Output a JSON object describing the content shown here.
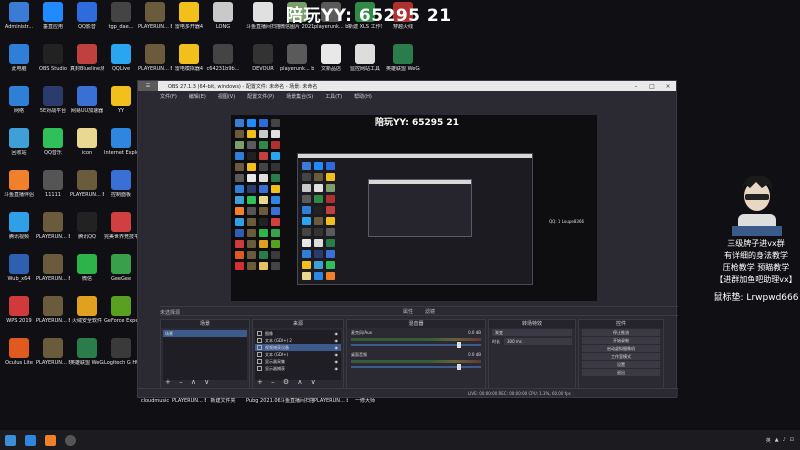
{
  "overlay_title": "陪玩YY: 65295 21",
  "side_info": {
    "lines": [
      "三级牌子进vx群",
      "有详细的身法教学",
      "压枪教学 预瞄教学",
      "【进群加鱼吧助理vx】"
    ],
    "mouse_label": "鼠标垫: Lrwpwd666"
  },
  "desktop_icons": [
    {
      "label": "Administr...",
      "color": "#3a7bd5"
    },
    {
      "label": "垂直应用",
      "color": "#1f8bff"
    },
    {
      "label": "QQ影音",
      "color": "#2e6bdc"
    },
    {
      "label": "tgp_dae...",
      "color": "#444"
    },
    {
      "label": "PLAYERUN... BATTLEGR...",
      "color": "#6b5b3d"
    },
    {
      "label": "雷电多开器4",
      "color": "#f2c01d"
    },
    {
      "label": "LONG",
      "color": "#c9c9c9"
    },
    {
      "label": "斗鱼直播间扫描()",
      "color": "#e0e0e0"
    },
    {
      "label": "微信图片 2021122...",
      "color": "#7a9f6a"
    },
    {
      "label": "playerunk... battlegrou...",
      "color": "#5a5a5a"
    },
    {
      "label": "新建 XLS 工作表",
      "color": "#2f8a46"
    },
    {
      "label": "穿越火线",
      "color": "#b03030"
    },
    {
      "label": "此电脑",
      "color": "#2f7fd8"
    },
    {
      "label": "OBS Studio",
      "color": "#222"
    },
    {
      "label": "真封Blueline测试版",
      "color": "#c04040"
    },
    {
      "label": "QQLive",
      "color": "#2aa5f0"
    },
    {
      "label": "PLAYERUN... BATTLEGR...",
      "color": "#6b5b3d"
    },
    {
      "label": "雷电模拟器4",
      "color": "#f2c01d"
    },
    {
      "label": "c64231b9b...",
      "color": "#444"
    },
    {
      "label": "DEVOUR",
      "color": "#333"
    },
    {
      "label": "playerunk... battlegrou...",
      "color": "#5a5a5a"
    },
    {
      "label": "文新品店",
      "color": "#e8e8e8"
    },
    {
      "label": "监控网站工具",
      "color": "#ddd"
    },
    {
      "label": "英雄联盟 WeGame版",
      "color": "#2a7d4a"
    },
    {
      "label": "网络",
      "color": "#2f7fd8"
    },
    {
      "label": "5E对战平台",
      "color": "#2b3b6b"
    },
    {
      "label": "网易UU加速器",
      "color": "#3a6fd5"
    },
    {
      "label": "YY",
      "color": "#f2c01d"
    },
    {
      "label": "回收站",
      "color": "#3fa0d8"
    },
    {
      "label": "QQ音乐",
      "color": "#30c05a"
    },
    {
      "label": "icon",
      "color": "#e8d890"
    },
    {
      "label": "Internet Explorer",
      "color": "#2e86de"
    },
    {
      "label": "斗鱼直播伴侣",
      "color": "#f0802a"
    },
    {
      "label": "11111",
      "color": "#555"
    },
    {
      "label": "PLAYERUN... BATTLEGR...",
      "color": "#6b5b3d"
    },
    {
      "label": "控制面板",
      "color": "#3a6fd5"
    },
    {
      "label": "腾讯视频",
      "color": "#2fa0e8"
    },
    {
      "label": "PLAYERUN... BATTLEGR...",
      "color": "#6b5b3d"
    },
    {
      "label": "腾讯QQ",
      "color": "#222"
    },
    {
      "label": "完美世界竞技平台",
      "color": "#d04040"
    },
    {
      "label": "Wub_x64",
      "color": "#2f5fb0"
    },
    {
      "label": "PLAYERUN... BATTLEGR...",
      "color": "#6b5b3d"
    },
    {
      "label": "微信",
      "color": "#2cb34a"
    },
    {
      "label": "GeeGee",
      "color": "#3a9f4a"
    },
    {
      "label": "WPS 2019",
      "color": "#d03a3a"
    },
    {
      "label": "PLAYERUN... BATTLEGR...",
      "color": "#6b5b3d"
    },
    {
      "label": "火绒安全软件",
      "color": "#e0a020"
    },
    {
      "label": "GeForce Experience",
      "color": "#5aa020"
    },
    {
      "label": "Oculus Lite",
      "color": "#e05a20"
    },
    {
      "label": "PLAYERUN... BATTLEGR...",
      "color": "#6b5b3d"
    },
    {
      "label": "英雄联盟 WeGame版",
      "color": "#2a7d4a"
    },
    {
      "label": "Logitech G HUB",
      "color": "#3a3a3a"
    },
    {
      "label": "cloudmusic",
      "color": "#d43030"
    },
    {
      "label": "PLAYERUN... BATTLEGR...",
      "color": "#6b5b3d"
    },
    {
      "label": "新建文件夹",
      "color": "#e8c060"
    },
    {
      "label": "Pubg 2021.06.10...",
      "color": "#444"
    },
    {
      "label": "斗鱼直播间扫描",
      "color": "#e0e0e0"
    },
    {
      "label": "PLAYERUN... battlegrou...",
      "color": "#5a5a5a"
    },
    {
      "label": "一修大师",
      "color": "#333"
    },
    {
      "label": "steam",
      "color": "#1b2838"
    },
    {
      "label": "腾讯游戏平台",
      "color": "#2a6fd0"
    }
  ],
  "obs": {
    "title": "OBS 27.1.3 (64-bit, windows) - 配置文件: 未命名 - 场景: 未命名",
    "menu": [
      "文件(F)",
      "编辑(E)",
      "视图(V)",
      "配置文件(P)",
      "场景集合(S)",
      "工具(T)",
      "帮助(H)"
    ],
    "mini_overlay": "陪玩YY: 65295 21",
    "mini_caption": "QQ: 1 Loupe8366",
    "scene_label": "未选择源",
    "toolbar": [
      "属性",
      "滤镜"
    ],
    "docks": {
      "scenes": {
        "title": "场景",
        "items": [
          "场景"
        ]
      },
      "sources": {
        "title": "来源",
        "items": [
          "图像",
          "文本 (GDI+) 2",
          "视频捕获设备",
          "文本 (GDI+)",
          "显示器采集",
          "显示器捕获"
        ]
      },
      "mixer": {
        "title": "混音器",
        "channels": [
          {
            "name": "麦克风/Aux",
            "level": "0.0 dB"
          },
          {
            "name": "桌面音频",
            "level": "0.0 dB"
          }
        ]
      },
      "transitions": {
        "title": "转场特效",
        "type": "渐变",
        "duration_label": "时长",
        "duration": "300 ms"
      },
      "controls": {
        "title": "控件",
        "buttons": [
          "停止推流",
          "开始录制",
          "启动虚拟摄像机",
          "工作室模式",
          "设置",
          "退出"
        ]
      }
    },
    "status": "LIVE: 00:00:00   REC: 00:00:00   CPU: 1.3%, 60.00 fps"
  },
  "taskbar": {
    "items": [
      {
        "name": "start",
        "color": "#3a8fd8"
      },
      {
        "name": "ie",
        "color": "#2e86de"
      },
      {
        "name": "douyu",
        "color": "#f0802a"
      },
      {
        "name": "obs",
        "color": "#555"
      }
    ],
    "tray": [
      "英",
      "▲",
      "♪",
      "⊡"
    ]
  }
}
